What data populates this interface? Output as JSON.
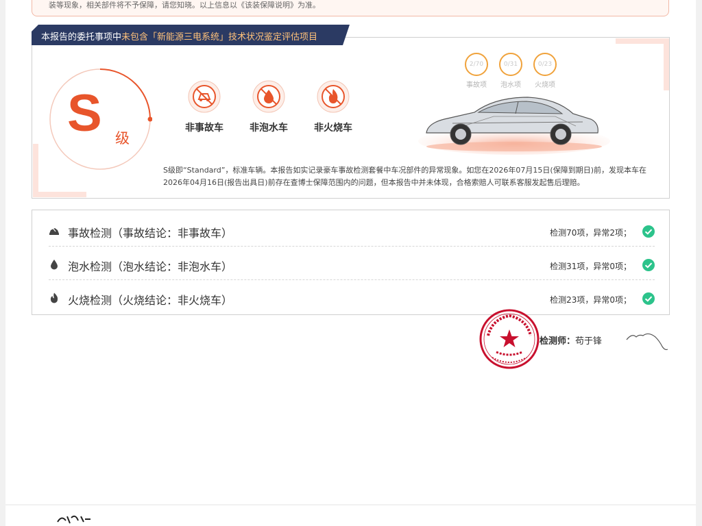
{
  "top_notice": {
    "text": "装等现象，相关部件将不予保障，请您知晓。以上信息以《该装保障说明》为准。"
  },
  "grade_banner": {
    "prefix": "本报告的委托事项中",
    "highlight": "未包含「新能源三电系统」技术状况鉴定评估项目"
  },
  "grade": {
    "letter": "S",
    "level_suffix": "级"
  },
  "badges": [
    {
      "label": "非事故车",
      "icon": "no-accident-icon"
    },
    {
      "label": "非泡水车",
      "icon": "no-flood-icon"
    },
    {
      "label": "非火烧车",
      "icon": "no-fire-icon"
    }
  ],
  "stats": [
    {
      "value": "2/70",
      "label": "事故项"
    },
    {
      "value": "0/31",
      "label": "泡水项"
    },
    {
      "value": "0/23",
      "label": "火烧项"
    }
  ],
  "grade_description": "S级即“Standard”，标准车辆。本报告如实记录豪车事故检测套餐中车况部件的异常现象。如您在2026年07月15日(保障到期日)前，发现本车在2026年04月16日(报告出具日)前存在查博士保障范围内的问题，但本报告中并未体现，合格索赔人可联系客服发起售后理赔。",
  "results": [
    {
      "title": "事故检测（事故结论：非事故车）",
      "summary": "检测70项，异常2项；",
      "icon": "car-crash-icon"
    },
    {
      "title": "泡水检测（泡水结论：非泡水车）",
      "summary": "检测31项，异常0项；",
      "icon": "water-drop-icon"
    },
    {
      "title": "火烧检测（火烧结论：非火烧车）",
      "summary": "检测23项，异常0项；",
      "icon": "flame-icon"
    }
  ],
  "inspector": {
    "label": "检测师：",
    "name": "苟于锋"
  },
  "stamp": {
    "top_text": "北京博伦鹏诚二手车鉴定评估有限公司",
    "bottom_text": "报告专用章",
    "number": "1101121005313"
  },
  "colors": {
    "accent": "#e8552b",
    "banner": "#2b3a63",
    "check": "#2cc38b",
    "stamp": "#c8102e"
  }
}
